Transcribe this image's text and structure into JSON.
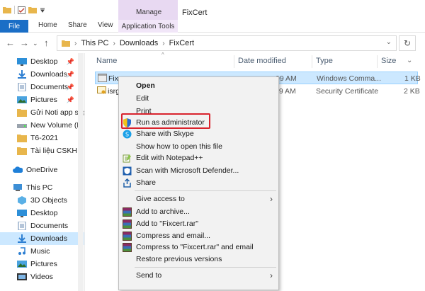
{
  "window": {
    "title": "FixCert",
    "manage_tab": "Manage"
  },
  "ribbon": {
    "tabs": [
      "File",
      "Home",
      "Share",
      "View"
    ],
    "app_tools": "Application Tools"
  },
  "address": {
    "crumbs": [
      "This PC",
      "Downloads",
      "FixCert"
    ],
    "back_icon": "arrow-left-icon",
    "forward_icon": "arrow-right-icon",
    "up_icon": "arrow-up-icon"
  },
  "nav": {
    "items": [
      {
        "label": "Desktop",
        "pinned": true,
        "icon": "desktop-icon"
      },
      {
        "label": "Downloads",
        "pinned": true,
        "icon": "downloads-icon"
      },
      {
        "label": "Documents",
        "pinned": true,
        "icon": "documents-icon"
      },
      {
        "label": "Pictures",
        "pinned": true,
        "icon": "pictures-icon"
      },
      {
        "label": "Gửi Noti app sap",
        "pinned": false,
        "icon": "folder-icon"
      },
      {
        "label": "New Volume (D:",
        "pinned": false,
        "icon": "drive-icon"
      },
      {
        "label": "T6-2021",
        "pinned": false,
        "icon": "folder-icon"
      },
      {
        "label": "Tài liệu CSKH",
        "pinned": false,
        "icon": "folder-icon"
      },
      {
        "label": "OneDrive",
        "pinned": false,
        "icon": "cloud-icon"
      },
      {
        "label": "This PC",
        "pinned": false,
        "icon": "computer-icon"
      },
      {
        "label": "3D Objects",
        "pinned": false,
        "icon": "cube-icon"
      },
      {
        "label": "Desktop",
        "pinned": false,
        "icon": "desktop-icon"
      },
      {
        "label": "Documents",
        "pinned": false,
        "icon": "documents-icon"
      },
      {
        "label": "Downloads",
        "pinned": false,
        "icon": "downloads-icon"
      },
      {
        "label": "Music",
        "pinned": false,
        "icon": "music-icon"
      },
      {
        "label": "Pictures",
        "pinned": false,
        "icon": "pictures-icon"
      },
      {
        "label": "Videos",
        "pinned": false,
        "icon": "videos-icon"
      }
    ]
  },
  "columns": {
    "name": "Name",
    "date": "Date modified",
    "type": "Type",
    "size": "Size"
  },
  "files": [
    {
      "name": "Fixc",
      "date": "09 AM",
      "type": "Windows Comma...",
      "size": "1 KB"
    },
    {
      "name": "isrg",
      "date": "09 AM",
      "type": "Security Certificate",
      "size": "2 KB"
    }
  ],
  "context_menu": {
    "items": [
      {
        "label": "Open",
        "bold": true
      },
      {
        "label": "Edit"
      },
      {
        "label": "Print"
      },
      {
        "label": "Run as administrator",
        "icon": "shield-icon"
      },
      {
        "label": "Share with Skype",
        "icon": "skype-icon"
      },
      {
        "label": "Show how to open this file"
      },
      {
        "label": "Edit with Notepad++",
        "icon": "notepadpp-icon"
      },
      {
        "label": "Scan with Microsoft Defender...",
        "icon": "defender-icon"
      },
      {
        "label": "Share",
        "icon": "share-icon"
      },
      {
        "label": "Give access to",
        "submenu": true
      },
      {
        "label": "Add to archive...",
        "icon": "winrar-icon"
      },
      {
        "label": "Add to \"Fixcert.rar\"",
        "icon": "winrar-icon"
      },
      {
        "label": "Compress and email...",
        "icon": "winrar-icon"
      },
      {
        "label": "Compress to \"Fixcert.rar\" and email",
        "icon": "winrar-icon"
      },
      {
        "label": "Restore previous versions"
      },
      {
        "label": "Send to",
        "submenu": true
      }
    ]
  },
  "colors": {
    "accent": "#1a6ec6",
    "manage": "#e8d9f2",
    "selection": "#cce8ff",
    "highlight": "#d9232d"
  }
}
